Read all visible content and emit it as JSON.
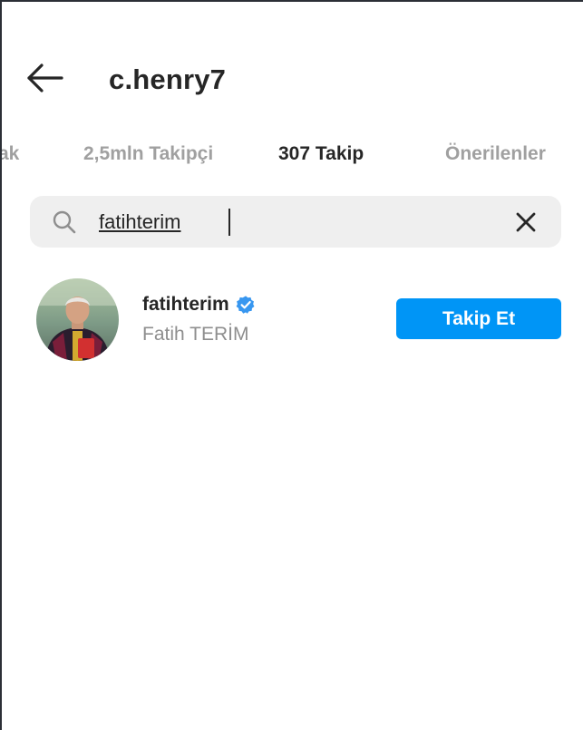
{
  "header": {
    "title": "c.henry7",
    "back_icon": "arrow-left-icon"
  },
  "tabs": [
    {
      "label": "ak",
      "active": false
    },
    {
      "label": "2,5mln Takipçi",
      "active": false
    },
    {
      "label": "307 Takip",
      "active": true
    },
    {
      "label": "Önerilenler",
      "active": false
    }
  ],
  "search": {
    "value": "fatihterim",
    "search_icon": "search-icon",
    "clear_icon": "close-icon"
  },
  "results": [
    {
      "username": "fatihterim",
      "full_name": "Fatih TERİM",
      "verified": true,
      "follow_label": "Takip Et"
    }
  ],
  "colors": {
    "accent": "#0095f6",
    "text": "#262626",
    "muted": "#8e8e8e",
    "tab_inactive": "#a0a0a0",
    "search_bg": "#efefef"
  }
}
